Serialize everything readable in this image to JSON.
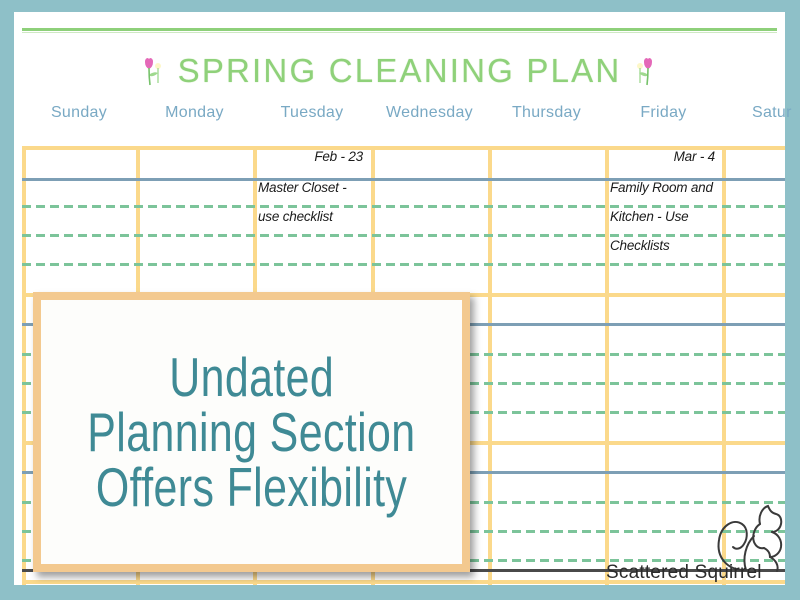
{
  "frame": {
    "border_color": "#8ec0c8",
    "page_background": "#ffffff"
  },
  "header": {
    "title": "SPRING CLEANING PLAN",
    "title_color": "#8fd17a",
    "left_icon": "tulip-icon",
    "right_icon": "tulip-icon"
  },
  "calendar": {
    "day_names": [
      "Sunday",
      "Monday",
      "Tuesday",
      "Wednesday",
      "Thursday",
      "Friday",
      "Satur"
    ],
    "day_name_color": "#79a9c4",
    "rule_colors": {
      "column": "#fbd98b",
      "week_divider": "#fbd98b",
      "date_line": "#7d9fb5",
      "note_line": "#7cc49a",
      "footer_line": "#4a4a4a"
    },
    "entries": [
      {
        "day": "Tuesday",
        "date": "Feb - 23",
        "lines": [
          "Master Closet -",
          "use checklist"
        ]
      },
      {
        "day": "Friday",
        "date": "Mar - 4",
        "lines": [
          "Family Room and",
          "Kitchen - Use",
          "Checklists"
        ]
      }
    ]
  },
  "overlay": {
    "lines": [
      "Undated",
      "Planning Section",
      "Offers Flexibility"
    ],
    "text_color": "#3f8a95",
    "border_color": "#f3c98f",
    "background_color": "#fdfdfb"
  },
  "branding": {
    "name": "Scattered Squirrel",
    "icon": "squirrel-icon"
  }
}
